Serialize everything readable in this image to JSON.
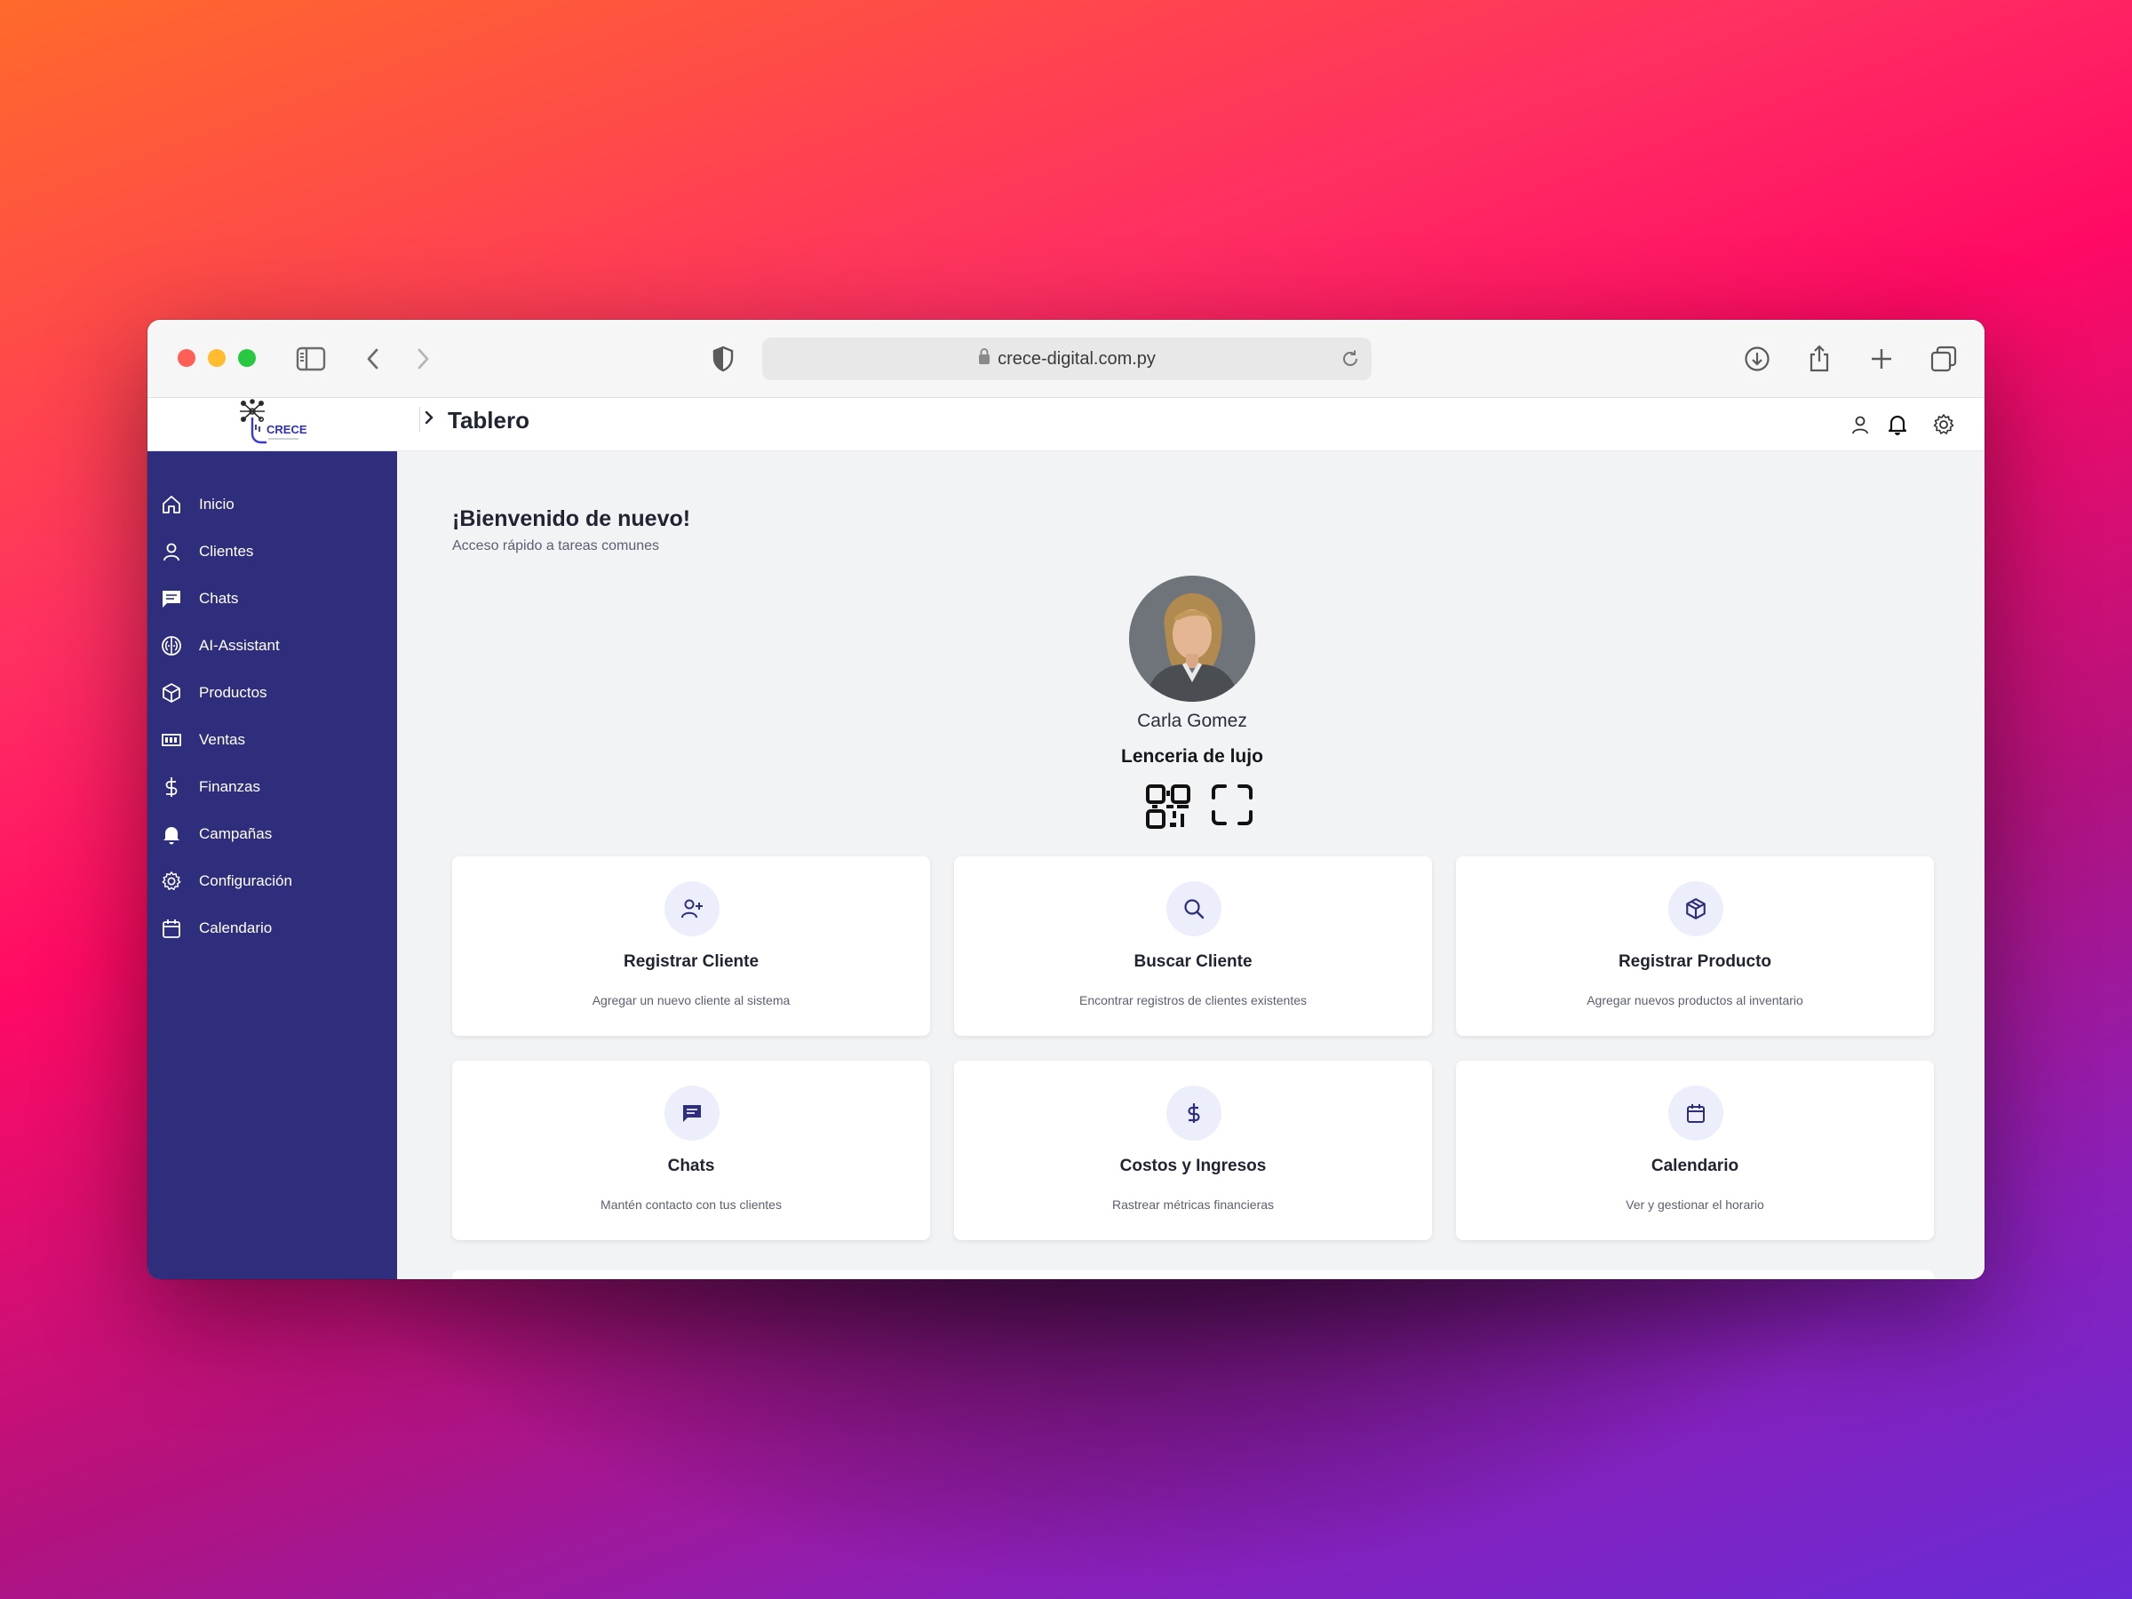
{
  "browser": {
    "url": "crece-digital.com.py"
  },
  "header": {
    "logo_text": "CRECE",
    "title": "Tablero"
  },
  "sidebar": {
    "items": [
      {
        "label": "Inicio",
        "icon": "home-icon"
      },
      {
        "label": "Clientes",
        "icon": "user-icon"
      },
      {
        "label": "Chats",
        "icon": "chat-icon"
      },
      {
        "label": "AI-Assistant",
        "icon": "brain-icon"
      },
      {
        "label": "Productos",
        "icon": "box-icon"
      },
      {
        "label": "Ventas",
        "icon": "counter-icon"
      },
      {
        "label": "Finanzas",
        "icon": "dollar-icon"
      },
      {
        "label": "Campañas",
        "icon": "bell-icon"
      },
      {
        "label": "Configuración",
        "icon": "gear-icon"
      },
      {
        "label": "Calendario",
        "icon": "calendar-icon"
      }
    ]
  },
  "main": {
    "welcome": "¡Bienvenido de nuevo!",
    "welcome_sub": "Acceso rápido a tareas comunes",
    "user_name": "Carla Gomez",
    "business": "Lenceria de lujo",
    "cards": [
      {
        "title": "Registrar Cliente",
        "desc": "Agregar un nuevo cliente al sistema",
        "icon": "user-plus-icon"
      },
      {
        "title": "Buscar Cliente",
        "desc": "Encontrar registros de clientes existentes",
        "icon": "search-icon"
      },
      {
        "title": "Registrar Producto",
        "desc": "Agregar nuevos productos al inventario",
        "icon": "box-icon"
      },
      {
        "title": "Chats",
        "desc": "Mantén contacto con tus clientes",
        "icon": "chat-icon"
      },
      {
        "title": "Costos y Ingresos",
        "desc": "Rastrear métricas financieras",
        "icon": "dollar-icon"
      },
      {
        "title": "Calendario",
        "desc": "Ver y gestionar el horario",
        "icon": "calendar-icon"
      }
    ]
  },
  "colors": {
    "sidebar": "#2f2e7c",
    "accent": "#2f2e7c",
    "main_bg": "#f2f3f5"
  }
}
